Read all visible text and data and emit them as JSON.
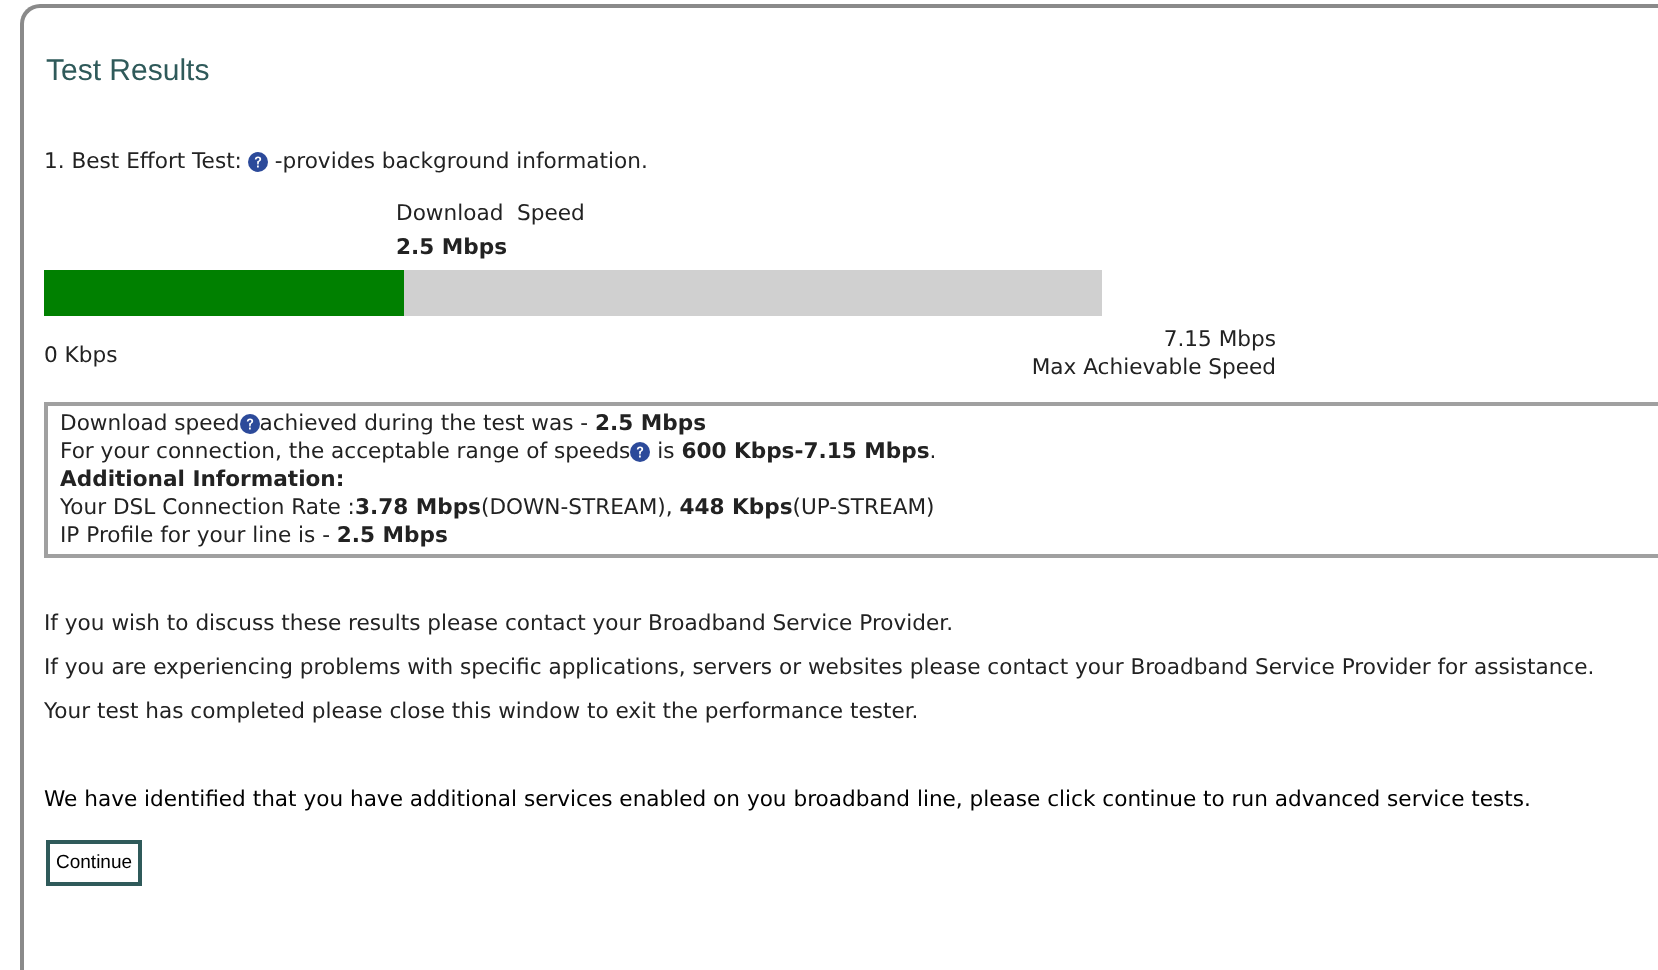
{
  "title": "Test Results",
  "test": {
    "before": "1. Best Effort Test:",
    "help_icon": true,
    "after": "-provides background information."
  },
  "meter": {
    "label": "Download  Speed",
    "value": "2.5 Mbps",
    "level": 0.34,
    "min_label": "0 Kbps",
    "max_value": "7.15 Mbps",
    "max_label": "Max Achievable Speed"
  },
  "info_lines": [
    {
      "before": "Download speed",
      "help_icon": true,
      "after": "achieved during the test was - **2.5 Mbps**"
    },
    {
      "before": "For your connection, the acceptable range of speeds",
      "help_icon": true,
      "after": " is **600 Kbps-7.15 Mbps**."
    },
    {
      "before": "**Additional Information:**",
      "help_icon": false
    },
    {
      "before": "Your DSL Connection Rate :**3.78 Mbps**(DOWN-STREAM), **448 Kbps**(UP-STREAM)",
      "help_icon": false
    },
    {
      "before": "IP Profile for your line is - **2.5 Mbps**",
      "help_icon": false
    }
  ],
  "messages": [
    "If you wish to discuss these results please contact your Broadband Service Provider.",
    "If you are experiencing problems with specific applications, servers or websites please contact your Broadband Service Provider for assistance.",
    "Your test has completed please close this window to exit the performance tester."
  ],
  "notice": "We have identified that you have additional services enabled on you broadband line, please click continue to run advanced service tests.",
  "button": "Continue"
}
